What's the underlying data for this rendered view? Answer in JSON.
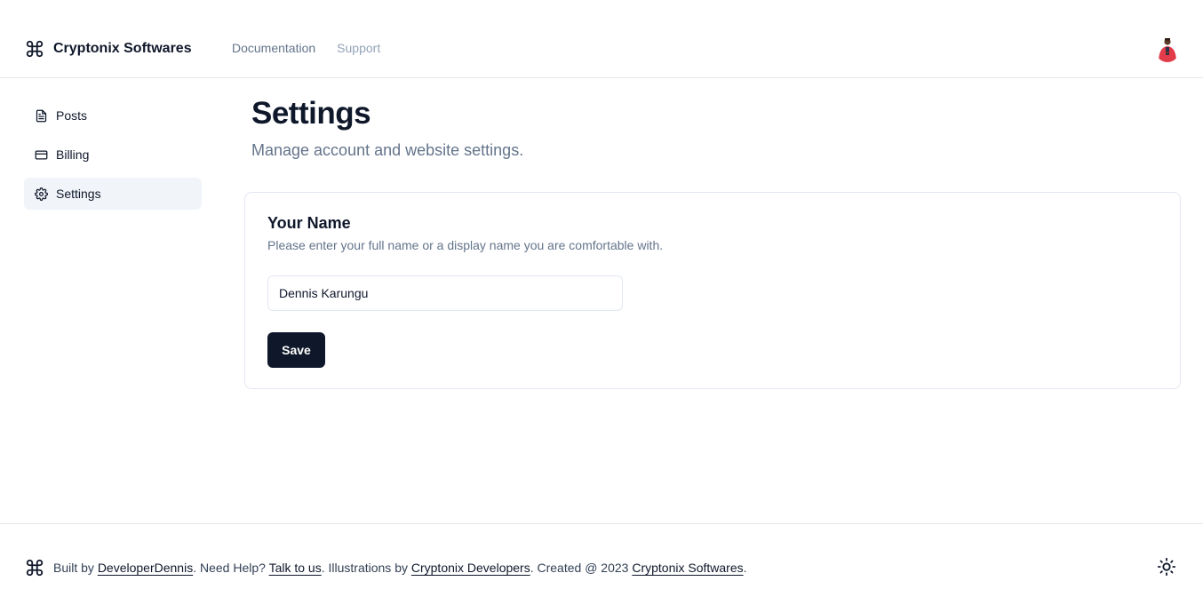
{
  "header": {
    "brand": "Cryptonix Softwares",
    "nav": [
      {
        "label": "Documentation"
      },
      {
        "label": "Support"
      }
    ],
    "avatar_icon": "user-avatar"
  },
  "sidebar": {
    "items": [
      {
        "label": "Posts",
        "icon": "file-text-icon"
      },
      {
        "label": "Billing",
        "icon": "credit-card-icon"
      },
      {
        "label": "Settings",
        "icon": "gear-icon",
        "active": true
      }
    ]
  },
  "main": {
    "title": "Settings",
    "subtitle": "Manage account and website settings.",
    "card": {
      "title": "Your Name",
      "description": "Please enter your full name or a display name you are comfortable with.",
      "name_value": "Dennis Karungu",
      "save_label": "Save"
    }
  },
  "footer": {
    "built_by": "Built by",
    "author_link": "DeveloperDennis",
    "need_help": ". Need Help?",
    "talk_link": "Talk to us",
    "illustrations": ". Illustrations by",
    "illustrator_link": "Cryptonix Developers",
    "created": ". Created @ 2023",
    "company_link": "Cryptonix Softwares",
    "end": ".",
    "theme_icon": "sun-icon"
  },
  "colors": {
    "primary": "#0f172a",
    "muted": "#64748b",
    "border": "#e2e8f0",
    "active_bg": "#f1f5f9"
  }
}
